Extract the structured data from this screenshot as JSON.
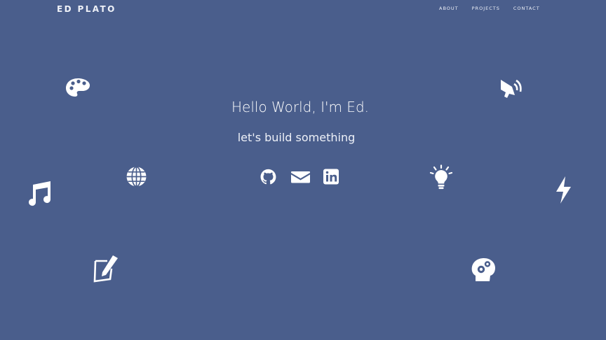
{
  "header": {
    "brand": "ED PLATO",
    "nav": [
      "ABOUT",
      "PROJECTS",
      "CONTACT"
    ]
  },
  "hero": {
    "title": "Hello World, I'm Ed.",
    "subtitle": "let's build something"
  },
  "social_links": [
    {
      "name": "github",
      "icon": "github-icon"
    },
    {
      "name": "email",
      "icon": "envelope-icon"
    },
    {
      "name": "linkedin",
      "icon": "linkedin-icon"
    }
  ],
  "decorative_icons": [
    "palette-icon",
    "megaphone-icon",
    "globe-icon",
    "music-note-icon",
    "lightbulb-icon",
    "lightning-icon",
    "sketch-pencil-icon",
    "head-gears-icon"
  ],
  "colors": {
    "background": "#4a5e8c",
    "foreground": "#ffffff"
  }
}
